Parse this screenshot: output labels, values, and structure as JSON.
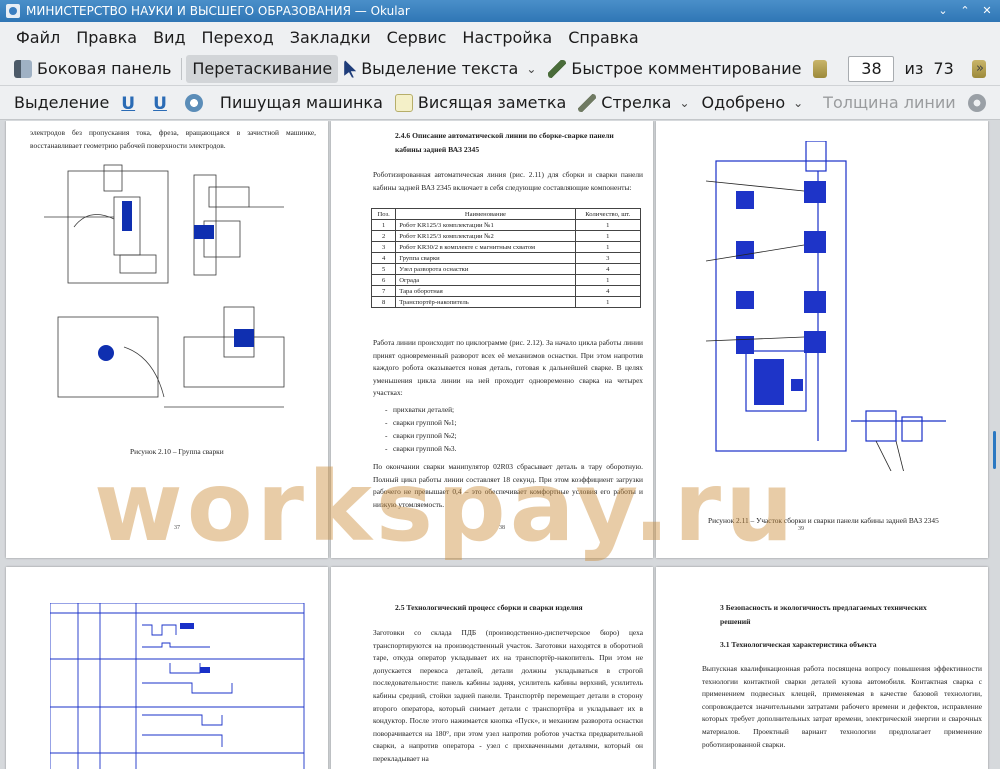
{
  "window": {
    "title": "МИНИСТЕРСТВО НАУКИ И ВЫСШЕГО ОБРАЗОВАНИЯ — Okular"
  },
  "menu": [
    "Файл",
    "Правка",
    "Вид",
    "Переход",
    "Закладки",
    "Сервис",
    "Настройка",
    "Справка"
  ],
  "toolbar": {
    "sidebar_label": "Боковая панель",
    "drag_label": "Перетаскивание",
    "text_select_label": "Выделение текста",
    "quick_annot_label": "Быстрое комментирование",
    "current_page": "38",
    "page_of": "из",
    "total_pages": "73"
  },
  "annot_toolbar": {
    "select_label": "Выделение",
    "typewriter_label": "Пишущая машинка",
    "note_label": "Висящая заметка",
    "arrow_label": "Стрелка",
    "stamp_label": "Одобрено",
    "line_width_label": "Толщина линии"
  },
  "watermark": "workspay.ru",
  "pages": {
    "p37": {
      "text_top": "электродов без пропускания тока, фреза, вращающаяся в зачистной машинке, восстанавливает геометрию рабочей поверхности электродов.",
      "caption": "Рисунок 2.10 – Группа сварки",
      "number": "37"
    },
    "p38": {
      "heading_line1": "2.4.6 Описание автоматической линии по сборке-сварке панели",
      "heading_line2": "кабины задней ВАЗ 2345",
      "intro": "Роботизированная автоматическая линия (рис. 2.11) для сборки и сварки панели кабины задней ВАЗ 2345 включает в себя следующие составляющие компоненты:",
      "table_headers": [
        "Поз.",
        "Наименование",
        "Количество, шт."
      ],
      "table_rows": [
        [
          "1",
          "Робот KR125/3 комплектации №1",
          "1"
        ],
        [
          "2",
          "Робот KR125/3 комплектации №2",
          "1"
        ],
        [
          "3",
          "Робот KR30/2 в комплекте с магнитным схватом",
          "1"
        ],
        [
          "4",
          "Группа сварки",
          "3"
        ],
        [
          "5",
          "Узел разворота оснастки",
          "4"
        ],
        [
          "6",
          "Ограда",
          "1"
        ],
        [
          "7",
          "Тара оборотная",
          "4"
        ],
        [
          "8",
          "Транспортёр-накопитель",
          "1"
        ]
      ],
      "para2": "Работа линии происходит по циклограмме (рис. 2.12). За начало цикла работы линии принят одновременный разворот всех её механизмов оснастки. При этом напротив каждого робота оказывается новая деталь, готовая к дальнейшей сварке. В целях уменьшения цикла линии на ней проходит одновременно сварка на четырех участках:",
      "list": [
        "прихватки деталей;",
        "сварки группой №1;",
        "сварки группой №2;",
        "сварки группой №3."
      ],
      "para3": "По окончании сварки манипулятор 02R03 сбрасывает деталь в тару оборотную. Полный цикл работы линии составляет 18 секунд. При этом коэффициент загрузки рабочего не превышает 0,4 – это обеспечивает комфортные условия его работы и низкую утомляемость.",
      "number": "38"
    },
    "p39": {
      "caption": "Рисунок 2.11 – Участок сборки и сварки панели кабины задней ВАЗ 2345",
      "number": "39"
    },
    "p41": {
      "heading": "2.5 Технологический процесс сборки и сварки изделия",
      "text": "Заготовки со склада ПДБ (производственно-диспетчерское бюро) цеха транспортируются на производственный участок. Заготовки находятся в оборотной таре, откуда оператор укладывает их на транспортёр-накопитель. При этом не допускается перекоса деталей, детали должны укладываться в строгой последовательности: панель кабины задняя, усилитель кабины верхний, усилитель кабины средний, стойки задней панели. Транспортёр перемещает детали в сторону второго оператора, который снимает детали с транспортёра и укладывает их в кондуктор. После этого нажимается кнопка «Пуск», и механизм разворота оснастки поворачивается на 180°, при этом узел напротив роботов участка предварительной сварки, а напротив оператора - узел с прихваченными деталями, который он перекладывает на"
    },
    "p42": {
      "heading_line1": "3 Безопасность и экологичность предлагаемых технических",
      "heading_line2": "решений",
      "subheading": "3.1 Технологическая характеристика объекта",
      "text": "Выпускная квалификационная работа посвящена вопросу повышения эффективности технологии контактной сварки деталей кузова автомобиля. Контактная сварка с применением подвесных клещей, применяемая в качестве базовой технологии, сопровождается значительными затратами рабочего времени и дефектов, исправление которых требует дополнительных затрат времени, электрической энергии и сварочных материалов. Проектный вариант технологии предполагает применение роботизированной сварки."
    }
  }
}
